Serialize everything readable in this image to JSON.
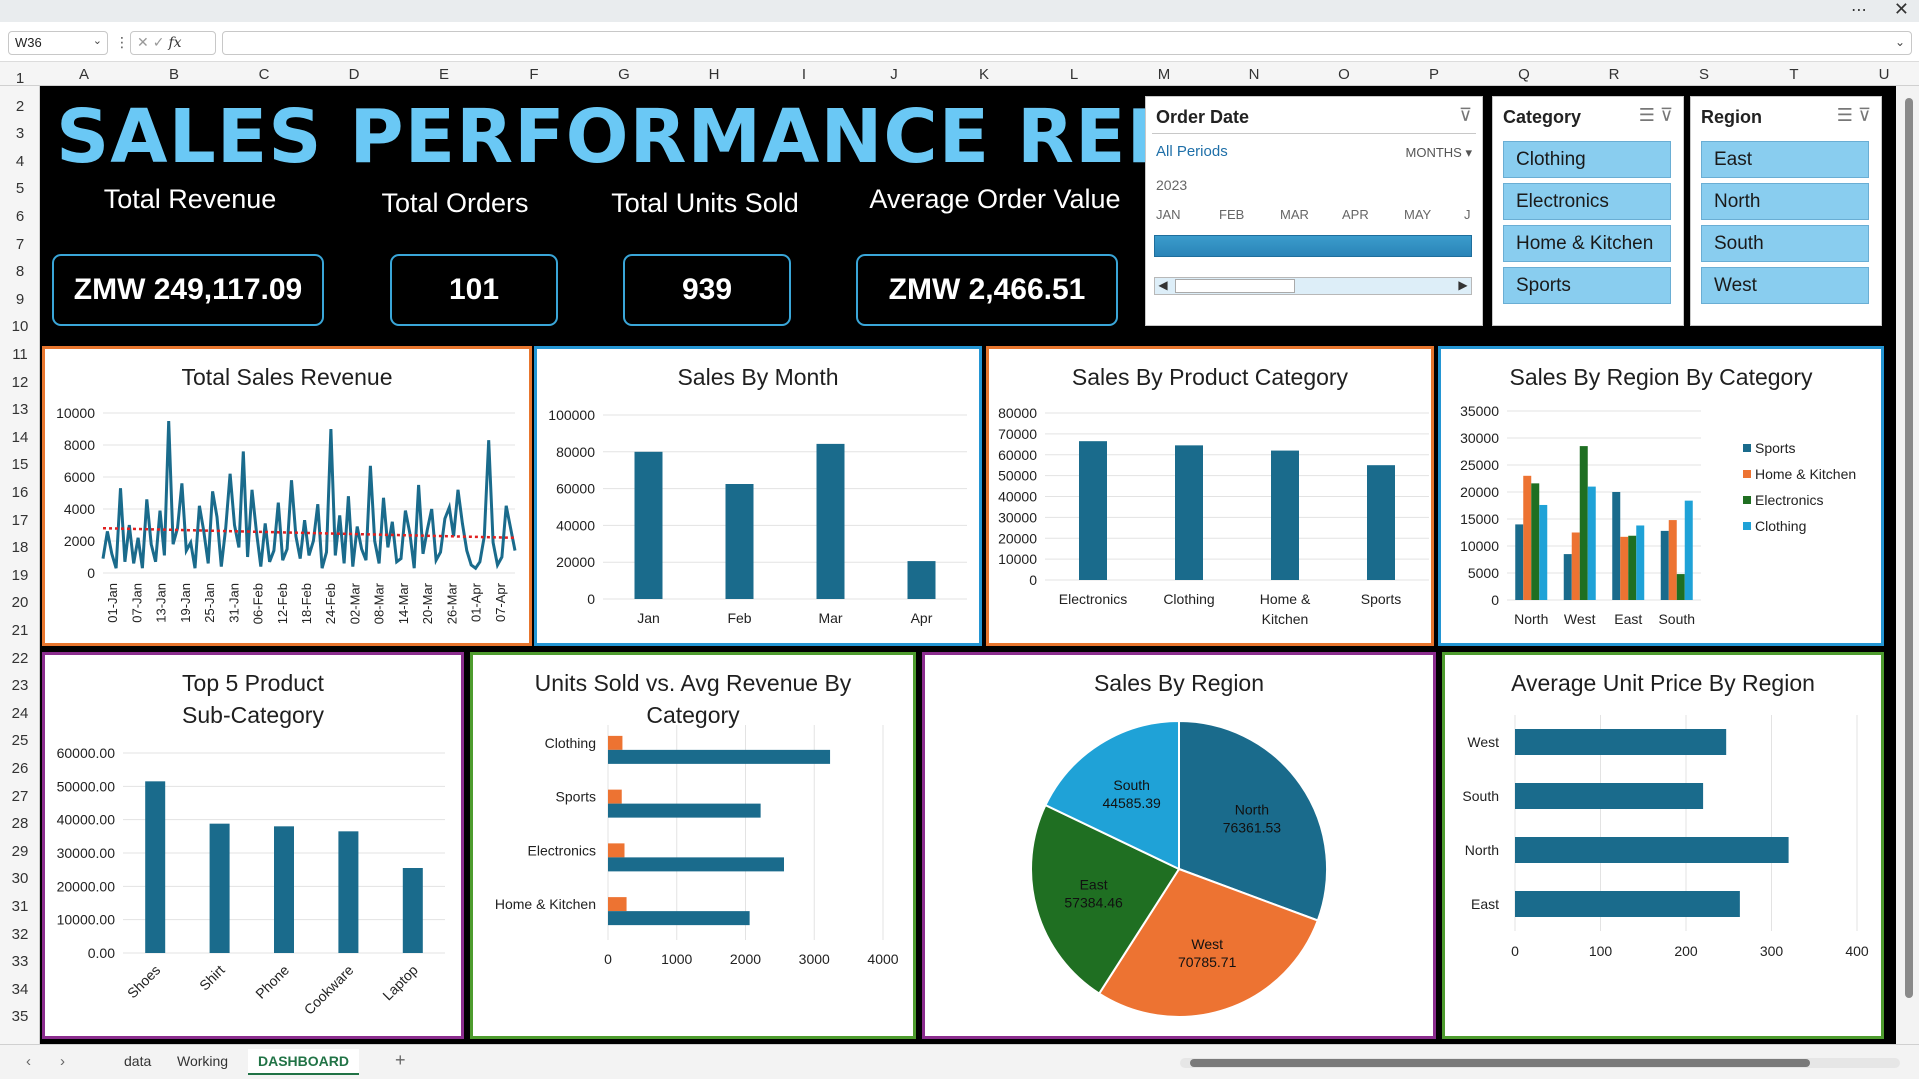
{
  "formula_bar": {
    "name_box": "W36",
    "fx": "fx"
  },
  "columns": [
    "A",
    "B",
    "C",
    "D",
    "E",
    "F",
    "G",
    "H",
    "I",
    "J",
    "K",
    "L",
    "M",
    "N",
    "O",
    "P",
    "Q",
    "R",
    "S",
    "T",
    "U"
  ],
  "rows": [
    "1",
    "2",
    "3",
    "4",
    "5",
    "6",
    "7",
    "8",
    "9",
    "10",
    "11",
    "12",
    "13",
    "14",
    "15",
    "16",
    "17",
    "18",
    "19",
    "20",
    "21",
    "22",
    "23",
    "24",
    "25",
    "26",
    "27",
    "28",
    "29",
    "30",
    "31",
    "32",
    "33",
    "34",
    "35"
  ],
  "dashboard": {
    "title": "SALES PERFORMANCE REPORT",
    "kpis": [
      {
        "label": "Total Revenue",
        "value": "ZMW 249,117.09"
      },
      {
        "label": "Total Orders",
        "value": "101"
      },
      {
        "label": "Total Units Sold",
        "value": "939"
      },
      {
        "label": "Average Order Value",
        "value": "ZMW 2,466.51"
      }
    ],
    "timeline": {
      "title": "Order Date",
      "selection": "All Periods",
      "level": "MONTHS",
      "year": "2023",
      "months": [
        "JAN",
        "FEB",
        "MAR",
        "APR",
        "MAY",
        "J"
      ]
    },
    "category_slicer": {
      "title": "Category",
      "items": [
        "Clothing",
        "Electronics",
        "Home & Kitchen",
        "Sports"
      ]
    },
    "region_slicer": {
      "title": "Region",
      "items": [
        "East",
        "North",
        "South",
        "West"
      ]
    },
    "colors": {
      "series_blue": "#1a6b8c",
      "orange": "#ed7332",
      "green": "#1f6f22",
      "light_blue": "#1fa2d7",
      "title": "#6ac8f5",
      "trend": "#e02020"
    }
  },
  "chart_data": [
    {
      "type": "line",
      "title": "Total Sales Revenue",
      "x": [
        "01-Jan",
        "07-Jan",
        "13-Jan",
        "19-Jan",
        "25-Jan",
        "31-Jan",
        "06-Feb",
        "12-Feb",
        "18-Feb",
        "24-Feb",
        "02-Mar",
        "08-Mar",
        "14-Mar",
        "20-Mar",
        "26-Mar",
        "01-Apr",
        "07-Apr"
      ],
      "values": [
        900,
        2600,
        1200,
        300,
        5300,
        700,
        3000,
        600,
        2200,
        300,
        4600,
        1800,
        700,
        3900,
        1100,
        9500,
        1800,
        2800,
        5600,
        1400,
        1900,
        300,
        4200,
        2600,
        600,
        5100,
        3500,
        400,
        2800,
        6200,
        3000,
        1600,
        7600,
        1000,
        5200,
        2600,
        400,
        3100,
        700,
        1400,
        4400,
        800,
        1500,
        5800,
        2300,
        900,
        3300,
        1100,
        2000,
        4300,
        300,
        1300,
        9000,
        1100,
        3600,
        600,
        4800,
        400,
        2900,
        1500,
        800,
        6700,
        2000,
        600,
        4700,
        1600,
        3200,
        700,
        900,
        3900,
        2500,
        300,
        5500,
        1200,
        2700,
        4000,
        800,
        1300,
        3400,
        4100,
        2300,
        5200,
        3100,
        1400,
        500,
        300,
        700,
        2300,
        8300,
        1900,
        500,
        1000,
        4200,
        2800,
        1400
      ],
      "trend_start": 2800,
      "trend_end": 2200,
      "ylim": [
        0,
        10000
      ],
      "yticks": [
        0,
        2000,
        4000,
        6000,
        8000,
        10000
      ]
    },
    {
      "type": "bar",
      "title": "Sales By Month",
      "categories": [
        "Jan",
        "Feb",
        "Mar",
        "Apr"
      ],
      "values": [
        80000,
        62500,
        84300,
        20600
      ],
      "ylim": [
        0,
        100000
      ],
      "yticks": [
        0,
        20000,
        40000,
        60000,
        80000,
        100000
      ]
    },
    {
      "type": "bar",
      "title": "Sales By Product Category",
      "categories": [
        "Electronics",
        "Clothing",
        "Home & Kitchen",
        "Sports"
      ],
      "values": [
        66500,
        64500,
        62000,
        55000
      ],
      "ylim": [
        0,
        80000
      ],
      "yticks": [
        0,
        10000,
        20000,
        30000,
        40000,
        50000,
        60000,
        70000,
        80000
      ]
    },
    {
      "type": "bar",
      "title": "Sales By Region By Category",
      "categories": [
        "North",
        "West",
        "East",
        "South"
      ],
      "series": [
        {
          "name": "Sports",
          "values": [
            14000,
            8500,
            20000,
            12800
          ]
        },
        {
          "name": "Home & Kitchen",
          "values": [
            23000,
            12500,
            11700,
            14800
          ]
        },
        {
          "name": "Electronics",
          "values": [
            21600,
            28500,
            11900,
            4800
          ]
        },
        {
          "name": "Clothing",
          "values": [
            17600,
            21000,
            13800,
            18400
          ]
        }
      ],
      "ylim": [
        0,
        35000
      ],
      "yticks": [
        0,
        5000,
        10000,
        15000,
        20000,
        25000,
        30000,
        35000
      ]
    },
    {
      "type": "bar",
      "title": "Top 5 Product Sub-Category",
      "title_lines": [
        "Top 5 Product",
        "Sub-Category"
      ],
      "categories": [
        "Shoes",
        "Shirt",
        "Phone",
        "Cookware",
        "Laptop"
      ],
      "values": [
        51500,
        38800,
        38000,
        36500,
        25500
      ],
      "ylim": [
        0,
        60000
      ],
      "yticks": [
        "0.00",
        "10000.00",
        "20000.00",
        "30000.00",
        "40000.00",
        "50000.00",
        "60000.00"
      ]
    },
    {
      "type": "bar",
      "title": "Units Sold vs. Avg Revenue By Category",
      "title_lines": [
        "Units Sold vs. Avg Revenue By",
        "Category"
      ],
      "categories": [
        "Clothing",
        "Sports",
        "Electronics",
        "Home & Kitchen"
      ],
      "series": [
        {
          "name": "Units Sold",
          "values": [
            210,
            200,
            240,
            270
          ]
        },
        {
          "name": "Avg Revenue",
          "values": [
            3230,
            2220,
            2560,
            2060
          ]
        }
      ],
      "xlim": [
        0,
        4000
      ],
      "xticks": [
        0,
        1000,
        2000,
        3000,
        4000
      ]
    },
    {
      "type": "pie",
      "title": "Sales By Region",
      "slices": [
        {
          "label": "North",
          "value": 76361.53,
          "text": "76361.53"
        },
        {
          "label": "West",
          "value": 70785.71,
          "text": "70785.71"
        },
        {
          "label": "East",
          "value": 57384.46,
          "text": "57384.46"
        },
        {
          "label": "South",
          "value": 44585.39,
          "text": "44585.39"
        }
      ]
    },
    {
      "type": "bar",
      "title": "Average Unit Price By Region",
      "categories": [
        "West",
        "South",
        "North",
        "East"
      ],
      "values": [
        247,
        220,
        320,
        263
      ],
      "xlim": [
        0,
        400
      ],
      "xticks": [
        0,
        100,
        200,
        300,
        400
      ]
    }
  ],
  "sheet_tabs": [
    "data",
    "Working",
    "DASHBOARD"
  ],
  "add_sheet": "+"
}
